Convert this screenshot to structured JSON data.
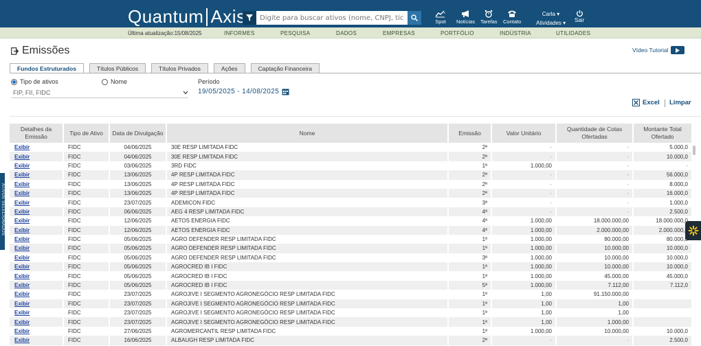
{
  "header": {
    "logo_left": "Quantum",
    "logo_right": "Axis",
    "search_placeholder": "Digite para buscar ativos (nome, CNPJ, ticker ou",
    "icons": [
      {
        "name": "spot-icon",
        "label": "Spot"
      },
      {
        "name": "megaphone-icon",
        "label": "Notícias"
      },
      {
        "name": "alarm-icon",
        "label": "Tarefas"
      },
      {
        "name": "phone-icon",
        "label": "Contato"
      }
    ],
    "user_name": "Carla",
    "activities_label": "Atividades",
    "logout_label": "Sair"
  },
  "navbar": {
    "last_update": "Última atualização:15/08/2025",
    "items": [
      "INFORMES",
      "PESQUISA",
      "DADOS",
      "EMPRESAS",
      "PORTFÓLIO",
      "INDÚSTRIA",
      "UTILIDADES"
    ]
  },
  "page": {
    "title": "Emissões",
    "video_tutorial": "Vídeo Tutorial"
  },
  "tabs": [
    "Fundos Estruturados",
    "Títulos Públicos",
    "Títulos Privados",
    "Ações",
    "Captação Financeira"
  ],
  "filters": {
    "radio_tipo": "Tipo de ativos",
    "radio_nome": "Nome",
    "select_value": "FIP, FII, FIDC",
    "period_label": "Período",
    "period_value": "19/05/2025 - 14/08/2025",
    "excel_label": "Excel",
    "limpar_label": "Limpar"
  },
  "table": {
    "headers": [
      "Detalhes da Emissão",
      "Tipo de Ativo",
      "Data de Divulgação",
      "Nome",
      "Emissão",
      "Valor Unitário",
      "Quantidade de Cotas Ofertadas",
      "Montante Total Ofertado"
    ],
    "rows": [
      [
        "Exibir",
        "FIDC",
        "04/06/2025",
        "30E RESP LIMITADA FIDC",
        "2ª",
        "-",
        "-",
        "5.000,0"
      ],
      [
        "Exibir",
        "FIDC",
        "04/06/2025",
        "30E RESP LIMITADA FIDC",
        "2ª",
        "-",
        "-",
        "10.000,0"
      ],
      [
        "Exibir",
        "FIDC",
        "03/06/2025",
        "3RD FIDC",
        "1ª",
        "1.000,00",
        "-",
        "-"
      ],
      [
        "Exibir",
        "FIDC",
        "13/06/2025",
        "4P RESP LIMITADA FIDC",
        "2ª",
        "-",
        "-",
        "56.000,0"
      ],
      [
        "Exibir",
        "FIDC",
        "13/06/2025",
        "4P RESP LIMITADA FIDC",
        "2ª",
        "-",
        "-",
        "8.000,0"
      ],
      [
        "Exibir",
        "FIDC",
        "13/06/2025",
        "4P RESP LIMITADA FIDC",
        "2ª",
        "-",
        "-",
        "16.000,0"
      ],
      [
        "Exibir",
        "FIDC",
        "23/07/2025",
        "ADEMICON FIDC",
        "3ª",
        "-",
        "-",
        "1.000,0"
      ],
      [
        "Exibir",
        "FIDC",
        "06/06/2025",
        "AEG 4 RESP LIMITADA FIDC",
        "4ª",
        "-",
        "-",
        "2.500,0"
      ],
      [
        "Exibir",
        "FIDC",
        "12/06/2025",
        "AETOS ENERGIA FIDC",
        "4ª",
        "1.000,00",
        "18.000.000,00",
        "18.000.000,0"
      ],
      [
        "Exibir",
        "FIDC",
        "12/06/2025",
        "AETOS ENERGIA FIDC",
        "4ª",
        "1.000,00",
        "2.000.000,00",
        "2.000.000,0"
      ],
      [
        "Exibir",
        "FIDC",
        "05/06/2025",
        "AGRO DEFENDER RESP LIMITADA FIDC",
        "1ª",
        "1.000,00",
        "80.000,00",
        "80.000,0"
      ],
      [
        "Exibir",
        "FIDC",
        "05/06/2025",
        "AGRO DEFENDER RESP LIMITADA FIDC",
        "1ª",
        "1.000,00",
        "10.000,00",
        "10.000,0"
      ],
      [
        "Exibir",
        "FIDC",
        "05/06/2025",
        "AGRO DEFENDER RESP LIMITADA FIDC",
        "3ª",
        "1.000,00",
        "10.000,00",
        "10.000,0"
      ],
      [
        "Exibir",
        "FIDC",
        "05/06/2025",
        "AGROCRED IB I FIDC",
        "1ª",
        "1.000,00",
        "10.000,00",
        "10.000,0"
      ],
      [
        "Exibir",
        "FIDC",
        "05/06/2025",
        "AGROCRED IB I FIDC",
        "1ª",
        "1.000,00",
        "45.000,00",
        "45.000,0"
      ],
      [
        "Exibir",
        "FIDC",
        "05/06/2025",
        "AGROCRED IB I FIDC",
        "5ª",
        "1.000,00",
        "7.112,00",
        "7.112,0"
      ],
      [
        "Exibir",
        "FIDC",
        "23/07/2025",
        "AGROJIVE I SEGMENTO AGRONEGÓCIO RESP LIMITADA FIDC",
        "1ª",
        "1,00",
        "91.150.000,00",
        ""
      ],
      [
        "Exibir",
        "FIDC",
        "23/07/2025",
        "AGROJIVE I SEGMENTO AGRONEGÓCIO RESP LIMITADA FIDC",
        "1ª",
        "1,00",
        "1,00",
        ""
      ],
      [
        "Exibir",
        "FIDC",
        "23/07/2025",
        "AGROJIVE I SEGMENTO AGRONEGÓCIO RESP LIMITADA FIDC",
        "1ª",
        "1,00",
        "1,00",
        ""
      ],
      [
        "Exibir",
        "FIDC",
        "23/07/2025",
        "AGROJIVE I SEGMENTO AGRONEGÓCIO RESP LIMITADA FIDC",
        "1ª",
        "1,00",
        "1.000,00",
        ""
      ],
      [
        "Exibir",
        "FIDC",
        "27/06/2025",
        "AGROMERCANTIL RESP LIMITADA FIDC",
        "1ª",
        "1.000,00",
        "10.000,00",
        "10.000,0"
      ],
      [
        "Exibir",
        "FIDC",
        "16/06/2025",
        "ALBAUGH RESP LIMITADA FIDC",
        "2ª",
        "-",
        "-",
        "2.500,0"
      ]
    ]
  },
  "side_tab": "ATIVOS SELECIONADOS",
  "colors": {
    "brand": "#154f7a",
    "navbar": "#dfe7d2",
    "link": "#1a3f9e",
    "row_alt": "#efefef"
  }
}
